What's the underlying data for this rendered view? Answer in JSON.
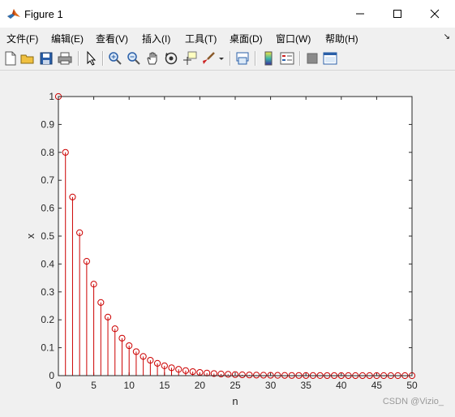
{
  "window": {
    "title": "Figure 1",
    "controls": [
      "minimize",
      "maximize",
      "close"
    ]
  },
  "menu": {
    "items": [
      "文件(F)",
      "编辑(E)",
      "查看(V)",
      "插入(I)",
      "工具(T)",
      "桌面(D)",
      "窗口(W)",
      "帮助(H)"
    ],
    "overflow_glyph": "↘"
  },
  "toolbar": {
    "icons": [
      "new-figure-icon",
      "open-file-icon",
      "save-icon",
      "print-icon",
      "pointer-icon",
      "zoom-in-icon",
      "zoom-out-icon",
      "pan-hand-icon",
      "rotate-3d-icon",
      "data-cursor-icon",
      "brush-icon",
      "dropdown-arrow-icon",
      "link-plot-icon",
      "colorbar-icon",
      "legend-icon",
      "hide-plot-tools-icon",
      "show-plot-tools-icon"
    ]
  },
  "chart_data": {
    "type": "stem",
    "title": "",
    "xlabel": "n",
    "ylabel": "x",
    "xlim": [
      0,
      50
    ],
    "ylim": [
      0,
      1
    ],
    "xticks": [
      0,
      5,
      10,
      15,
      20,
      25,
      30,
      35,
      40,
      45,
      50
    ],
    "yticks": [
      0,
      0.1,
      0.2,
      0.3,
      0.4,
      0.5,
      0.6,
      0.7,
      0.8,
      0.9,
      1
    ],
    "series_color": "#cc0000",
    "grid": false,
    "x": [
      0,
      1,
      2,
      3,
      4,
      5,
      6,
      7,
      8,
      9,
      10,
      11,
      12,
      13,
      14,
      15,
      16,
      17,
      18,
      19,
      20,
      21,
      22,
      23,
      24,
      25,
      26,
      27,
      28,
      29,
      30,
      31,
      32,
      33,
      34,
      35,
      36,
      37,
      38,
      39,
      40,
      41,
      42,
      43,
      44,
      45,
      46,
      47,
      48,
      49,
      50
    ],
    "y": [
      1.0,
      0.8,
      0.64,
      0.512,
      0.4096,
      0.3277,
      0.2621,
      0.2097,
      0.1678,
      0.1342,
      0.1074,
      0.0859,
      0.0687,
      0.055,
      0.044,
      0.0352,
      0.0281,
      0.0225,
      0.018,
      0.0144,
      0.0115,
      0.0092,
      0.0074,
      0.0059,
      0.0047,
      0.0038,
      0.003,
      0.0024,
      0.0019,
      0.0015,
      0.0012,
      0.001,
      0.0008,
      0.0006,
      0.0005,
      0.0004,
      0.0003,
      0.0003,
      0.0002,
      0.0002,
      0.0001,
      0.0001,
      0.0001,
      0.0001,
      0.0001,
      0.0,
      0.0,
      0.0,
      0.0,
      0.0,
      0.0
    ]
  },
  "watermark": "CSDN @Vizio_"
}
